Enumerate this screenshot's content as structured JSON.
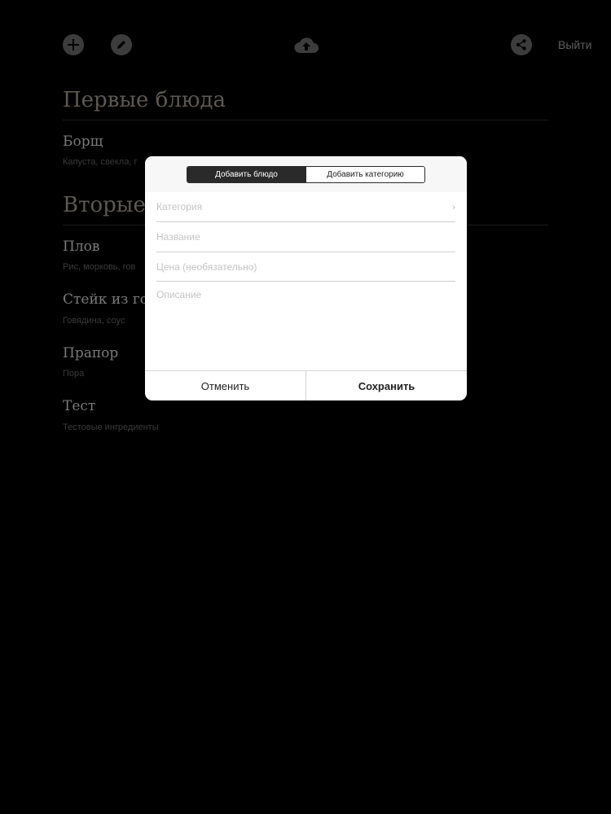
{
  "toolbar": {
    "add_icon": "plus-icon",
    "edit_icon": "pencil-icon",
    "upload_icon": "cloud-upload-icon",
    "share_icon": "share-icon",
    "logout_label": "Выйти"
  },
  "menu": {
    "sections": [
      {
        "title": "Первые блюда",
        "dishes": [
          {
            "name": "Борщ",
            "desc": "Капуста, свекла, г"
          }
        ]
      },
      {
        "title": "Вторые",
        "dishes": [
          {
            "name": "Плов",
            "desc": "Рис, морковь, гов"
          },
          {
            "name": "Стейк из гов",
            "desc": "Говядина, соус"
          },
          {
            "name": "Прапор",
            "desc": "Пора"
          },
          {
            "name": "Тест",
            "desc": "Тестовые ингредиенты"
          }
        ]
      }
    ]
  },
  "modal": {
    "tabs": [
      "Добавить блюдо",
      "Добавить категорию"
    ],
    "fields": {
      "category": "Категория",
      "name": "Название",
      "price": "Цена (необязательно)",
      "description": "Описание"
    },
    "chevron": "›",
    "cancel": "Отменить",
    "save": "Сохранить"
  },
  "colors": {
    "background": "#000000",
    "modal_bg": "#ffffff",
    "segment_active": "#2a2a2a"
  }
}
